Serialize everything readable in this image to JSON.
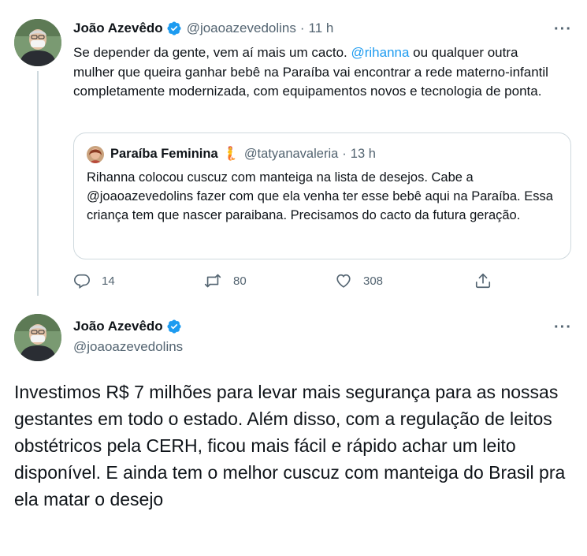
{
  "tweet1": {
    "author_name": "João Azevêdo",
    "author_handle": "@joaoazevedolins",
    "time_sep": "·",
    "time": "11 h",
    "more": "···",
    "text_part1": "Se depender da gente, vem aí mais um cacto. ",
    "mention": "@rihanna",
    "text_part2": " ou qualquer outra mulher que queira ganhar bebê na Paraíba vai encontrar a rede materno-infantil completamente modernizada, com equipamentos novos e tecnologia de ponta.",
    "quote": {
      "author_name": "Paraíba Feminina",
      "author_emoji": "🧜",
      "author_handle": "@tatyanavaleria",
      "time_sep": "·",
      "time": "13 h",
      "text": "Rihanna colocou cuscuz com manteiga na lista de desejos. Cabe a @joaoazevedolins fazer com que ela venha ter esse bebê aqui na Paraíba. Essa criança tem que nascer paraibana. Precisamos do cacto da futura geração."
    },
    "actions": {
      "replies": "14",
      "retweets": "80",
      "likes": "308"
    }
  },
  "tweet2": {
    "author_name": "João Azevêdo",
    "author_handle": "@joaoazevedolins",
    "more": "···",
    "text": "Investimos R$ 7 milhões para levar mais segurança para as nossas gestantes em todo o estado. Além disso, com a regulação de leitos obstétricos pela CERH, ficou mais fácil e rápido achar um leito disponível. E ainda tem o melhor cuscuz com manteiga do Brasil pra ela matar o desejo"
  },
  "colors": {
    "accent": "#1d9bf0",
    "secondary_text": "#536471",
    "border": "#cfd9de"
  }
}
